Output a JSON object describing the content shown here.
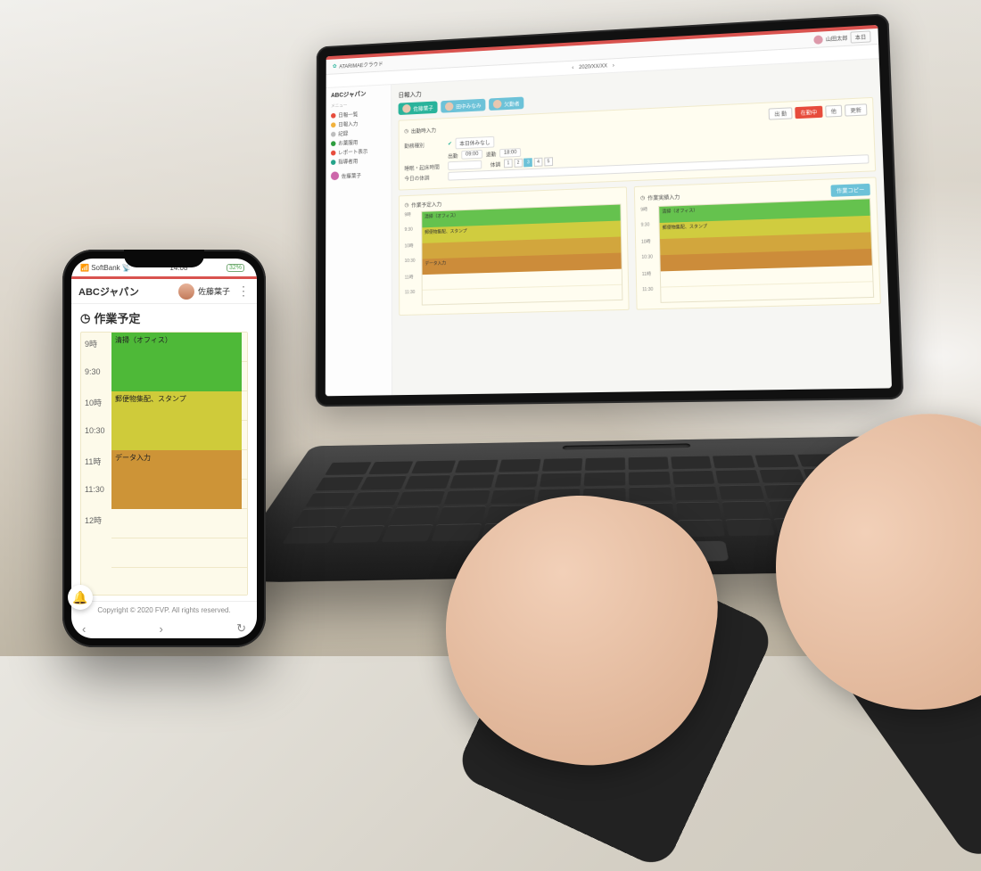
{
  "laptop": {
    "app_name": "ATARIMAEクラウド",
    "top_user": "山田太郎",
    "top_button": "本日",
    "date_nav": {
      "date": "2020/XX/XX"
    },
    "sidebar": {
      "org": "ABCジャパン",
      "menu_label": "メニュー",
      "items": [
        {
          "color": "#e74c3c",
          "label": "日報一覧"
        },
        {
          "color": "#f1b13b",
          "label": "日報入力"
        },
        {
          "color": "#bdbdbd",
          "label": "記録"
        },
        {
          "color": "#2e9e3f",
          "label": "お薬服用"
        },
        {
          "color": "#e74c3c",
          "label": "レポート表示"
        },
        {
          "color": "#25a38a",
          "label": "指導者用"
        }
      ],
      "manager": "佐藤葉子"
    },
    "content": {
      "page_title": "日報入力",
      "staff": [
        {
          "name": "佐藤葉子",
          "color": "#29b39b"
        },
        {
          "name": "田中みなみ",
          "color": "#6cc2d8"
        },
        {
          "name": "欠勤者",
          "color": "#6cc2d8"
        }
      ],
      "attendance": {
        "title": "出勤時入力",
        "buttons": {
          "attend": "出 勤",
          "inoffice": "在勤中",
          "other": "他",
          "update": "更新"
        },
        "work_status_label": "勤務種別",
        "work_status_value": "本日休みなし",
        "start_label": "出勤",
        "start_val": "09:00",
        "end_label": "退勤",
        "end_val": "18:00",
        "sleep_label": "睡眠・起床時間",
        "mood_label": "体調",
        "mood_levels": [
          "1",
          "2",
          "3",
          "4",
          "5"
        ],
        "mood_selected": 2,
        "today_note_label": "今日の体調"
      },
      "schedule_left": {
        "title": "作業予定入力",
        "times": [
          "9時",
          "9:30",
          "10時",
          "10:30",
          "11時",
          "11:30"
        ],
        "bars": [
          {
            "label": "清掃（オフィス）",
            "cls": "green"
          },
          {
            "label": "郵便物集配、スタンプ",
            "cls": "yellow"
          },
          {
            "label": "",
            "cls": "olive"
          },
          {
            "label": "データ入力",
            "cls": "orange"
          }
        ]
      },
      "schedule_right": {
        "title": "作業実績入力",
        "button": "作業コピー",
        "times": [
          "9時",
          "9:30",
          "10時",
          "10:30",
          "11時",
          "11:30"
        ],
        "bars": [
          {
            "label": "清掃（オフィス）",
            "cls": "green"
          },
          {
            "label": "郵便物集配、スタンプ",
            "cls": "yellow"
          },
          {
            "label": "",
            "cls": "olive"
          },
          {
            "label": "",
            "cls": "orange"
          }
        ]
      }
    }
  },
  "phone": {
    "status": {
      "carrier": "SoftBank",
      "time": "14:08",
      "battery": "32%"
    },
    "app_title": "ABCジャパン",
    "user_name": "佐藤葉子",
    "screen_title": "作業予定",
    "times": [
      "9時",
      "9:30",
      "10時",
      "10:30",
      "11時",
      "11:30",
      "12時"
    ],
    "tasks": [
      {
        "label": "清掃（オフィス）",
        "cls": "green"
      },
      {
        "label": "郵便物集配、スタンプ",
        "cls": "yellow"
      },
      {
        "label": "データ入力",
        "cls": "orange"
      }
    ],
    "copyright": "Copyright © 2020 FVP. All rights reserved."
  },
  "icons": {
    "clock": "◷",
    "bell": "🔔",
    "signal": "📶",
    "wifi": "📡",
    "refresh": "↻",
    "chev_l": "‹",
    "chev_r": "›",
    "kebab": "⋮"
  },
  "colors": {
    "accent_red": "#d9534f",
    "teal": "#29b39b",
    "blue": "#6cc2d8"
  }
}
